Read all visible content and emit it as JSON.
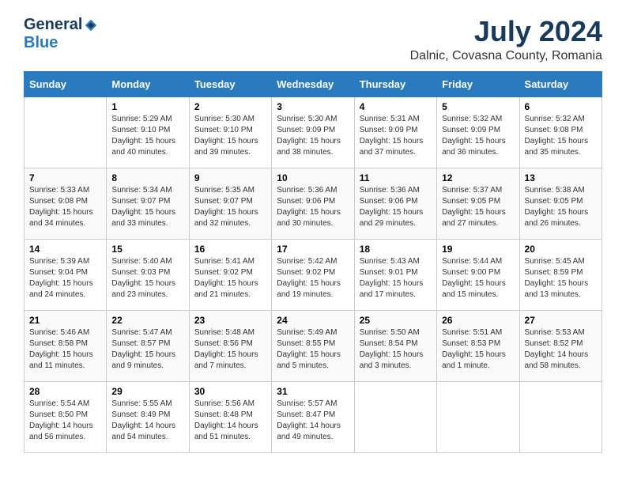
{
  "header": {
    "logo_general": "General",
    "logo_blue": "Blue",
    "month_year": "July 2024",
    "location": "Dalnic, Covasna County, Romania"
  },
  "calendar": {
    "days_of_week": [
      "Sunday",
      "Monday",
      "Tuesday",
      "Wednesday",
      "Thursday",
      "Friday",
      "Saturday"
    ],
    "weeks": [
      [
        {
          "day": "",
          "info": ""
        },
        {
          "day": "1",
          "info": "Sunrise: 5:29 AM\nSunset: 9:10 PM\nDaylight: 15 hours\nand 40 minutes."
        },
        {
          "day": "2",
          "info": "Sunrise: 5:30 AM\nSunset: 9:10 PM\nDaylight: 15 hours\nand 39 minutes."
        },
        {
          "day": "3",
          "info": "Sunrise: 5:30 AM\nSunset: 9:09 PM\nDaylight: 15 hours\nand 38 minutes."
        },
        {
          "day": "4",
          "info": "Sunrise: 5:31 AM\nSunset: 9:09 PM\nDaylight: 15 hours\nand 37 minutes."
        },
        {
          "day": "5",
          "info": "Sunrise: 5:32 AM\nSunset: 9:09 PM\nDaylight: 15 hours\nand 36 minutes."
        },
        {
          "day": "6",
          "info": "Sunrise: 5:32 AM\nSunset: 9:08 PM\nDaylight: 15 hours\nand 35 minutes."
        }
      ],
      [
        {
          "day": "7",
          "info": "Sunrise: 5:33 AM\nSunset: 9:08 PM\nDaylight: 15 hours\nand 34 minutes."
        },
        {
          "day": "8",
          "info": "Sunrise: 5:34 AM\nSunset: 9:07 PM\nDaylight: 15 hours\nand 33 minutes."
        },
        {
          "day": "9",
          "info": "Sunrise: 5:35 AM\nSunset: 9:07 PM\nDaylight: 15 hours\nand 32 minutes."
        },
        {
          "day": "10",
          "info": "Sunrise: 5:36 AM\nSunset: 9:06 PM\nDaylight: 15 hours\nand 30 minutes."
        },
        {
          "day": "11",
          "info": "Sunrise: 5:36 AM\nSunset: 9:06 PM\nDaylight: 15 hours\nand 29 minutes."
        },
        {
          "day": "12",
          "info": "Sunrise: 5:37 AM\nSunset: 9:05 PM\nDaylight: 15 hours\nand 27 minutes."
        },
        {
          "day": "13",
          "info": "Sunrise: 5:38 AM\nSunset: 9:05 PM\nDaylight: 15 hours\nand 26 minutes."
        }
      ],
      [
        {
          "day": "14",
          "info": "Sunrise: 5:39 AM\nSunset: 9:04 PM\nDaylight: 15 hours\nand 24 minutes."
        },
        {
          "day": "15",
          "info": "Sunrise: 5:40 AM\nSunset: 9:03 PM\nDaylight: 15 hours\nand 23 minutes."
        },
        {
          "day": "16",
          "info": "Sunrise: 5:41 AM\nSunset: 9:02 PM\nDaylight: 15 hours\nand 21 minutes."
        },
        {
          "day": "17",
          "info": "Sunrise: 5:42 AM\nSunset: 9:02 PM\nDaylight: 15 hours\nand 19 minutes."
        },
        {
          "day": "18",
          "info": "Sunrise: 5:43 AM\nSunset: 9:01 PM\nDaylight: 15 hours\nand 17 minutes."
        },
        {
          "day": "19",
          "info": "Sunrise: 5:44 AM\nSunset: 9:00 PM\nDaylight: 15 hours\nand 15 minutes."
        },
        {
          "day": "20",
          "info": "Sunrise: 5:45 AM\nSunset: 8:59 PM\nDaylight: 15 hours\nand 13 minutes."
        }
      ],
      [
        {
          "day": "21",
          "info": "Sunrise: 5:46 AM\nSunset: 8:58 PM\nDaylight: 15 hours\nand 11 minutes."
        },
        {
          "day": "22",
          "info": "Sunrise: 5:47 AM\nSunset: 8:57 PM\nDaylight: 15 hours\nand 9 minutes."
        },
        {
          "day": "23",
          "info": "Sunrise: 5:48 AM\nSunset: 8:56 PM\nDaylight: 15 hours\nand 7 minutes."
        },
        {
          "day": "24",
          "info": "Sunrise: 5:49 AM\nSunset: 8:55 PM\nDaylight: 15 hours\nand 5 minutes."
        },
        {
          "day": "25",
          "info": "Sunrise: 5:50 AM\nSunset: 8:54 PM\nDaylight: 15 hours\nand 3 minutes."
        },
        {
          "day": "26",
          "info": "Sunrise: 5:51 AM\nSunset: 8:53 PM\nDaylight: 15 hours\nand 1 minute."
        },
        {
          "day": "27",
          "info": "Sunrise: 5:53 AM\nSunset: 8:52 PM\nDaylight: 14 hours\nand 58 minutes."
        }
      ],
      [
        {
          "day": "28",
          "info": "Sunrise: 5:54 AM\nSunset: 8:50 PM\nDaylight: 14 hours\nand 56 minutes."
        },
        {
          "day": "29",
          "info": "Sunrise: 5:55 AM\nSunset: 8:49 PM\nDaylight: 14 hours\nand 54 minutes."
        },
        {
          "day": "30",
          "info": "Sunrise: 5:56 AM\nSunset: 8:48 PM\nDaylight: 14 hours\nand 51 minutes."
        },
        {
          "day": "31",
          "info": "Sunrise: 5:57 AM\nSunset: 8:47 PM\nDaylight: 14 hours\nand 49 minutes."
        },
        {
          "day": "",
          "info": ""
        },
        {
          "day": "",
          "info": ""
        },
        {
          "day": "",
          "info": ""
        }
      ]
    ]
  }
}
